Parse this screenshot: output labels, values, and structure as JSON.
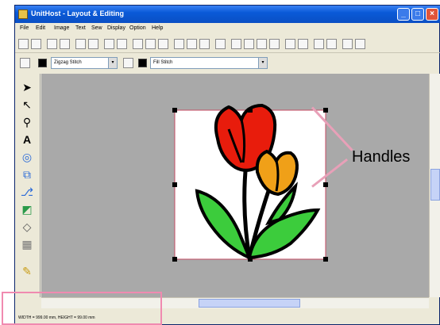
{
  "window": {
    "title": "UnitHost - Layout & Editing",
    "buttons": {
      "minimize": "_",
      "maximize": "□",
      "close": "×"
    }
  },
  "menu": [
    "File",
    "Edit",
    "Image",
    "Text",
    "Sew",
    "Display",
    "Option",
    "Help"
  ],
  "toolbar2": {
    "line_style": "Zigzag Stitch",
    "fill_style": "Fill Stitch"
  },
  "canvas": {
    "background": "#a9a9a9",
    "selection_color": "#c44a62"
  },
  "status_bar": {
    "text": "WIDTH = 999.00 mm, HEIGHT = 99.00 mm"
  },
  "annotation": {
    "label": "Handles",
    "color": "#e8a0b8"
  },
  "icons": {
    "tools": [
      "select-arrow-icon",
      "point-edit-icon",
      "zoom-icon",
      "text-icon",
      "circle-icon",
      "rectangle-icon",
      "stitch-icon",
      "fill-icon",
      "eraser-icon",
      "ruler-icon",
      "pencil-icon"
    ]
  }
}
